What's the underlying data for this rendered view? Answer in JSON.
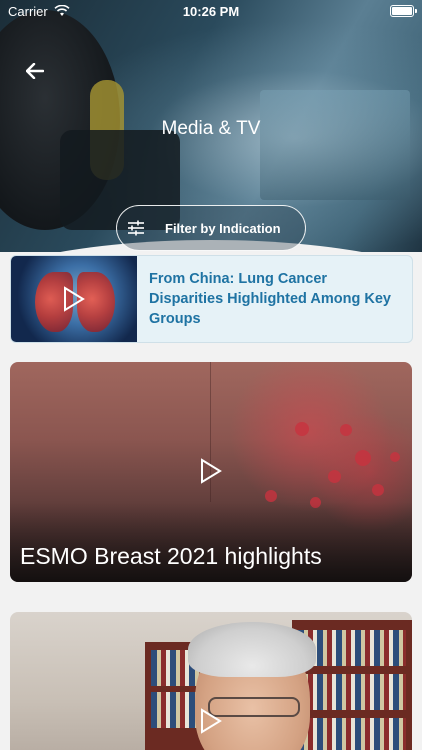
{
  "status_bar": {
    "carrier": "Carrier",
    "time": "10:26 PM",
    "battery_level": 1.0
  },
  "header": {
    "title": "Media & TV",
    "filter_label": "Filter by Indication",
    "back_icon": "arrow-left-icon",
    "filter_icon": "sliders-icon"
  },
  "articles": [
    {
      "title": "From China: Lung Cancer Disparities Highlighted Among Key Groups"
    }
  ],
  "videos": [
    {
      "title": "ESMO Breast 2021 highlights"
    },
    {
      "title": ""
    }
  ],
  "colors": {
    "accent": "#1f73a3",
    "article_bg": "#e6f2f7",
    "page_bg": "#f2f2f2"
  }
}
